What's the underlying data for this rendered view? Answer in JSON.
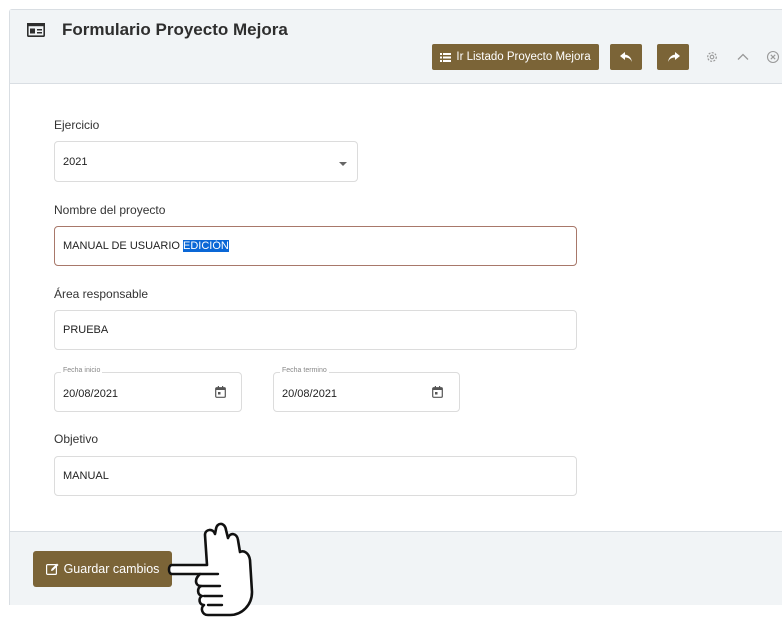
{
  "header": {
    "title": "Formulario Proyecto Mejora",
    "list_button_label": "Ir Listado Proyecto Mejora",
    "title_icon": "id-card-icon",
    "toolbar_icons": [
      "undo-icon",
      "redo-icon",
      "gear-icon",
      "chevron-up-icon",
      "close-circle-icon"
    ]
  },
  "form": {
    "ejercicio": {
      "label": "Ejercicio",
      "value": "2021"
    },
    "nombre": {
      "label": "Nombre del proyecto",
      "value_plain": "MANUAL DE USUARIO ",
      "value_selected": "EDICIÓN"
    },
    "area": {
      "label": "Área responsable",
      "value": "PRUEBA"
    },
    "fecha_inicio": {
      "label": "Fecha inicio",
      "value": "20/08/2021"
    },
    "fecha_termino": {
      "label": "Fecha termino",
      "value": "20/08/2021"
    },
    "objetivo": {
      "label": "Objetivo",
      "value": "MANUAL"
    }
  },
  "footer": {
    "save_label": "Guardar cambios"
  },
  "colors": {
    "accent": "#7b6437",
    "header_bg": "#f1f4f6",
    "selection": "#0a67d6",
    "focus_border": "#a8786a"
  }
}
